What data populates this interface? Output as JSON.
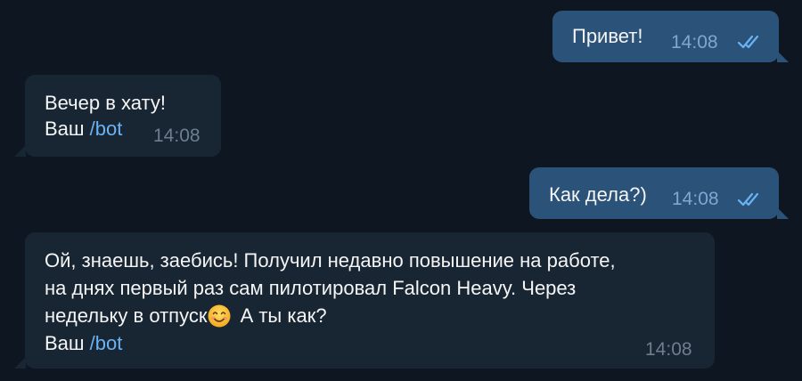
{
  "messages": [
    {
      "text": "Привет!",
      "time": "14:08",
      "status_icon": "double-check-read-icon"
    },
    {
      "line1": "Вечер в хату!",
      "prefix": "Ваш ",
      "command": "/bot",
      "time": "14:08"
    },
    {
      "text": "Как дела?)",
      "time": "14:08",
      "status_icon": "double-check-read-icon"
    },
    {
      "line1": "Ой, знаешь, заебись! Получил недавно повышение на работе,",
      "line2": "на днях первый раз сам пилотировал Falcon Heavy. Через",
      "line3_before": "недельку в отпуск",
      "line3_after": " А ты как?",
      "emoji": "smiling-face-emoji",
      "prefix": "Ваш ",
      "command": "/bot",
      "time": "14:08"
    }
  ],
  "colors": {
    "background": "#0e1621",
    "outgoing_bubble": "#2b5278",
    "incoming_bubble": "#182533",
    "text": "#f5f5f5",
    "link": "#6ab3f3",
    "read_check": "#6ab3f3"
  }
}
